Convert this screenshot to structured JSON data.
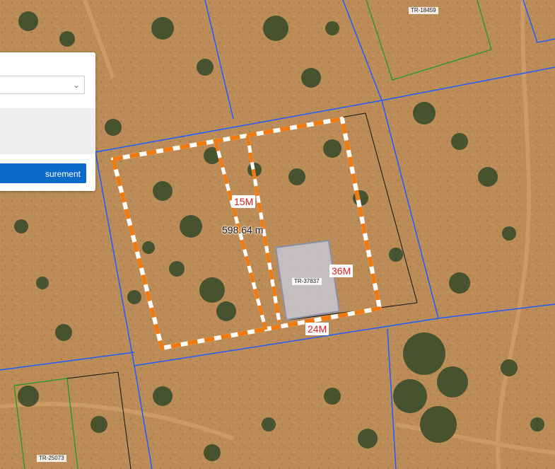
{
  "panel": {
    "select_value": "",
    "info_text": "",
    "measure_button_label": "surement"
  },
  "measurements": {
    "segment_a": "15M",
    "segment_b": "36M",
    "segment_c": "24M",
    "total_distance": "598.64 m"
  },
  "parcels": {
    "north_east": "TR-18459",
    "selected": "TR-37837",
    "south_west": "TR-25073"
  },
  "colors": {
    "terrain": "#b98a55",
    "vegetation": "#3a4a2a",
    "parcel_boundary": "#1f5cff",
    "secondary_boundary": "#1f9a1f",
    "measure_line": "#f07a10",
    "measure_dash": "#ffffff",
    "label_text": "#e01b1b",
    "primary_button": "#0b6bc9"
  }
}
